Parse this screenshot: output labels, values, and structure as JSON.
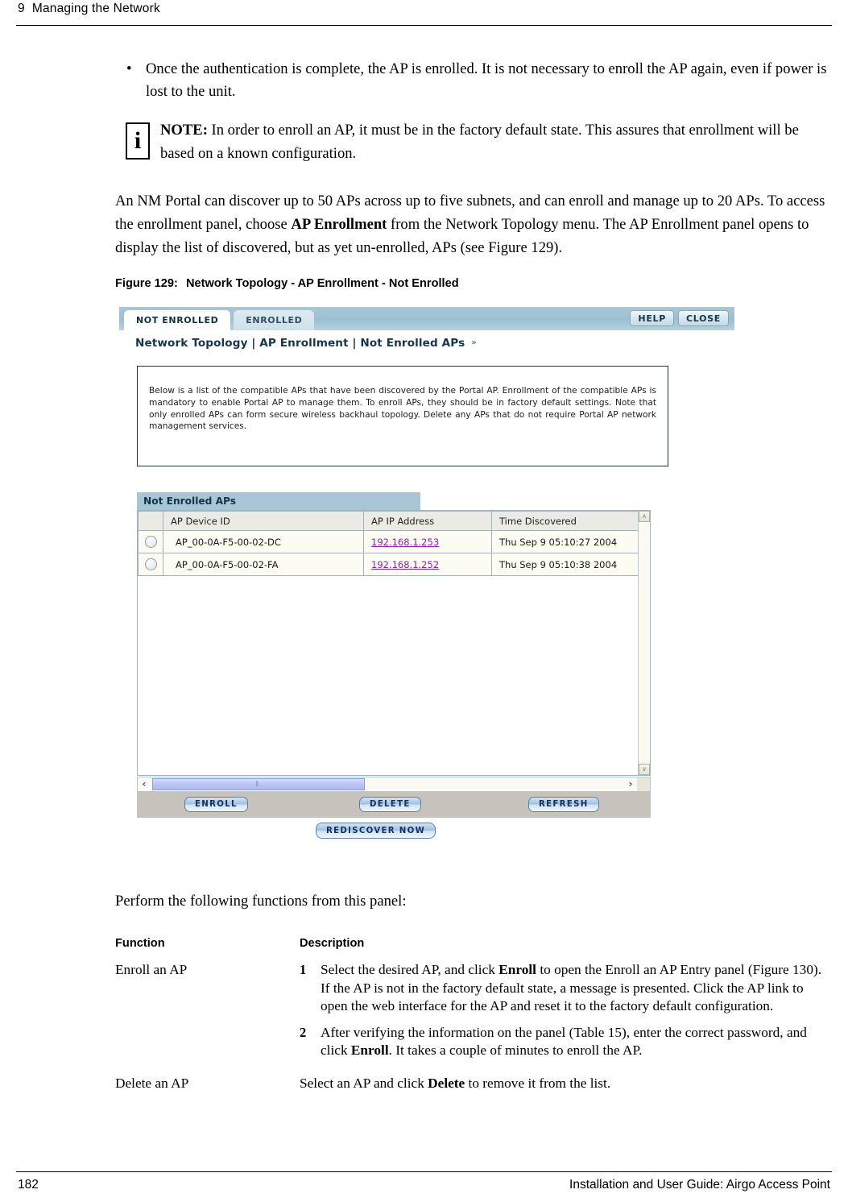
{
  "page": {
    "header_text": "9  Managing the Network",
    "footer_page_number": "182",
    "footer_guide_title": "Installation and User Guide: Airgo Access Point"
  },
  "body": {
    "bullet_mark": "•",
    "bullet_text": "Once the authentication is complete, the AP is enrolled. It is not necessary to enroll the AP again, even if power is lost to the unit.",
    "note": {
      "icon_glyph": "i",
      "label": "NOTE:",
      "text": " In order to enroll an AP, it must be in the factory default state. This assures that enrollment will be based on a known configuration."
    },
    "paragraph": {
      "part1": "An NM Portal can discover up to 50 APs across up to five subnets, and can enroll and manage up to 20 APs. To access the enrollment panel, choose ",
      "bold": "AP Enrollment",
      "part2": " from the Network Topology menu. The AP Enrollment panel opens to display the list of discovered, but as yet un-enrolled, APs (see Figure 129)."
    },
    "figure_caption": {
      "number": "Figure 129:",
      "title": "Network Topology - AP Enrollment - Not Enrolled"
    },
    "lead_in": "Perform the following functions from this panel:"
  },
  "screenshot": {
    "tabs": [
      {
        "label": "NOT ENROLLED",
        "active": true
      },
      {
        "label": "ENROLLED",
        "active": false
      }
    ],
    "top_buttons": [
      {
        "label": "HELP"
      },
      {
        "label": "CLOSE"
      }
    ],
    "breadcrumb": "Network Topology | AP Enrollment | Not Enrolled APs",
    "breadcrumb_chevron": "»",
    "info_text": "Below is a list of the compatible APs that have been discovered by the Portal AP. Enrollment of the compatible APs is mandatory to enable Portal AP to manage them. To enroll APs, they should be in factory default settings. Note that only enrolled APs can form secure wireless backhaul topology. Delete any APs that do not require Portal AP network management services.",
    "section_header": "Not Enrolled APs",
    "table": {
      "columns": [
        "",
        "AP Device ID",
        "AP IP Address",
        "Time Discovered"
      ],
      "rows": [
        {
          "selected": false,
          "device_id": "AP_00-0A-F5-00-02-DC",
          "ip_address": "192.168.1.253",
          "time_discovered": "Thu Sep 9 05:10:27 2004"
        },
        {
          "selected": false,
          "device_id": "AP_00-0A-F5-00-02-FA",
          "ip_address": "192.168.1.252",
          "time_discovered": "Thu Sep 9 05:10:38 2004"
        }
      ]
    },
    "scrollbar": {
      "up_arrow": "∧",
      "down_arrow": "∨",
      "left_arrow": "‹",
      "right_arrow": "›",
      "grip": "Ⅱ"
    },
    "buttons": {
      "enroll": "ENROLL",
      "delete": "DELETE",
      "refresh": "REFRESH",
      "rediscover": "REDISCOVER NOW"
    },
    "colors": {
      "topband": "#a9c7d6",
      "section_header": "#a8c6d5",
      "link": "#8c1fa6",
      "row_background": "#fdfcf2",
      "button_bar": "#c7c3bc"
    }
  },
  "function_table": {
    "headers": [
      "Function",
      "Description"
    ],
    "rows": [
      {
        "function": "Enroll an AP",
        "steps": [
          {
            "num": "1",
            "part1": "Select the desired AP, and click ",
            "bold1": "Enroll",
            "part2": " to open the Enroll an AP Entry panel (Figure 130). If the AP is not in the factory default state, a message is presented. Click the AP link to open the web interface for the AP and reset it to the factory default configuration."
          },
          {
            "num": "2",
            "part1": "After verifying the information on the panel (Table 15), enter the correct password, and click ",
            "bold1": "Enroll",
            "part2": ". It takes a couple of minutes to enroll the AP."
          }
        ]
      },
      {
        "function": "Delete an AP",
        "simple": {
          "part1": "Select an AP and click ",
          "bold1": "Delete",
          "part2": " to remove it from the list."
        }
      }
    ]
  }
}
